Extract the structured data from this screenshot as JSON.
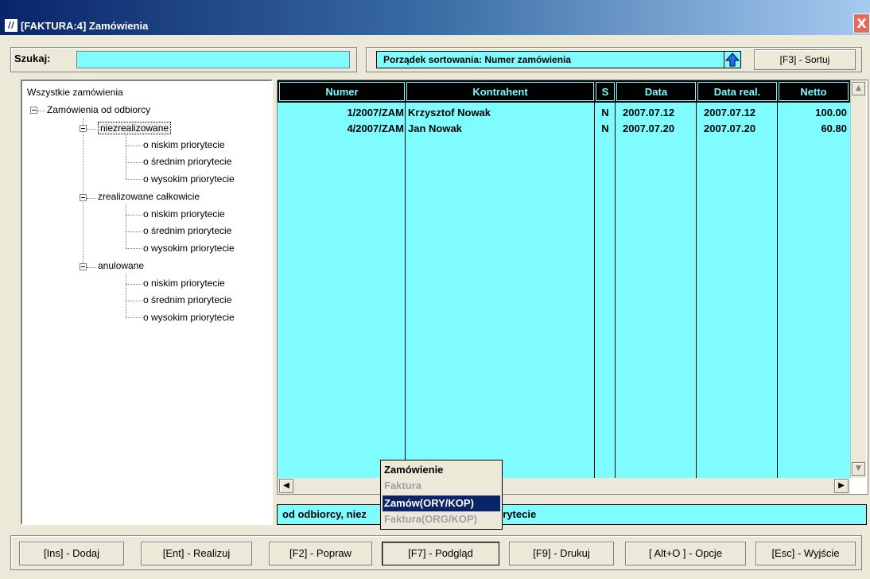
{
  "window": {
    "title": "[FAKTURA:4]  Zamówienia",
    "app_icon": "faktura-app-icon",
    "close_label": "X"
  },
  "search": {
    "label": "Szukaj:",
    "value": ""
  },
  "sort": {
    "text": "Porządek sortowania: Numer zamówienia",
    "direction_icon": "sort-up-arrow-icon",
    "button_label": "[F3] - Sortuj"
  },
  "tree": {
    "root": "Wszystkie zamówienia",
    "group": "Zamówienia od odbiorcy",
    "categories": [
      {
        "label": "niezrealizowane",
        "children": [
          "o niskim priorytecie",
          "o średnim priorytecie",
          "o wysokim priorytecie"
        ]
      },
      {
        "label": "zrealizowane całkowicie",
        "children": [
          "o niskim priorytecie",
          "o średnim priorytecie",
          "o wysokim priorytecie"
        ]
      },
      {
        "label": "anulowane",
        "children": [
          "o niskim priorytecie",
          "o średnim priorytecie",
          "o wysokim priorytecie"
        ]
      }
    ]
  },
  "grid": {
    "columns": [
      "Numer",
      "Kontrahent",
      "S",
      "Data",
      "Data real.",
      "Netto"
    ],
    "rows": [
      [
        "1/2007/ZAM",
        "Krzysztof Nowak",
        "N",
        "2007.07.12",
        "2007.07.12",
        "100.00"
      ],
      [
        "4/2007/ZAM",
        "Jan Nowak",
        "N",
        "2007.07.20",
        "2007.07.20",
        "60.80"
      ]
    ]
  },
  "status": {
    "left": "od odbiorcy, niez",
    "right": "im priorytecie"
  },
  "popup_menu": {
    "items": [
      {
        "label": "Zamówienie",
        "state": "normal"
      },
      {
        "label": "Faktura",
        "state": "disabled"
      },
      {
        "label": "Zamów(ORY/KOP)",
        "state": "active"
      },
      {
        "label": "Faktura(ORG/KOP)",
        "state": "disabled"
      }
    ]
  },
  "buttons": [
    {
      "label": "[Ins] - Dodaj"
    },
    {
      "label": "[Ent] - Realizuj"
    },
    {
      "label": "[F2] - Popraw"
    },
    {
      "label": "[F7] - Podgląd"
    },
    {
      "label": "[F9] - Drukuj"
    },
    {
      "label": "[ Alt+O ] - Opcje"
    },
    {
      "label": "[Esc] - Wyjście"
    }
  ],
  "colors": {
    "accent_cyan": "#7ffcff",
    "title_blue": "#0a246a",
    "window_bg": "#ece9d8"
  }
}
